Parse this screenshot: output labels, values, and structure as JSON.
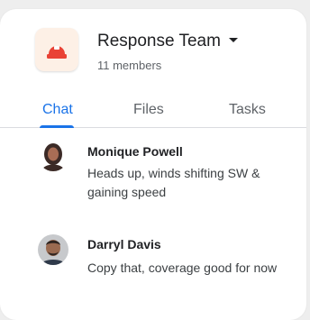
{
  "group": {
    "name": "Response Team",
    "members": "11 members",
    "icon": "emergency-light-icon",
    "icon_color": "#e94235",
    "avatar_bg": "#fdf0e6"
  },
  "tabs": [
    {
      "label": "Chat",
      "active": true
    },
    {
      "label": "Files",
      "active": false
    },
    {
      "label": "Tasks",
      "active": false
    }
  ],
  "messages": [
    {
      "sender": "Monique Powell",
      "text": "Heads up, winds shifting SW & gaining speed"
    },
    {
      "sender": "Darryl Davis",
      "text": "Copy that, coverage good for now"
    }
  ],
  "colors": {
    "accent": "#1a73e8",
    "text": "#202124",
    "secondary_text": "#5f6368"
  }
}
